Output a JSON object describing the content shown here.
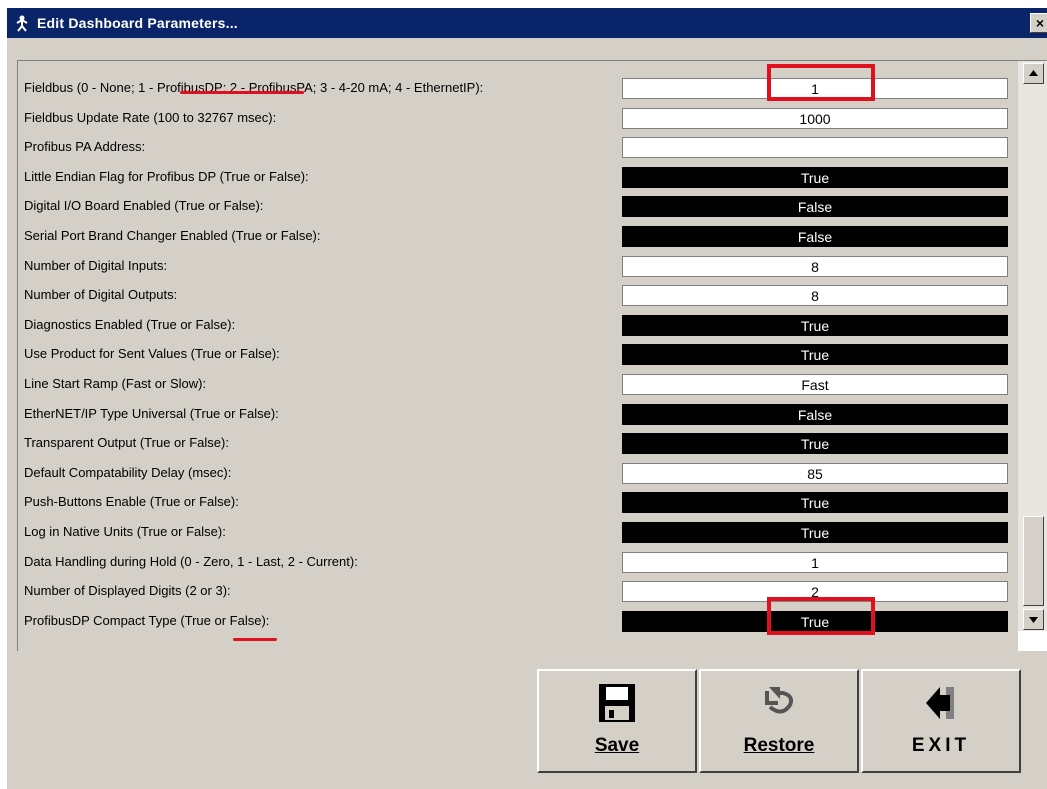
{
  "window": {
    "title": "Edit Dashboard Parameters...",
    "close_label": "×"
  },
  "parameters": [
    {
      "label": "Fieldbus (0 - None; 1 - ProfibusDP; 2 - ProfibusPA; 3 - 4-20 mA; 4 - EthernetIP):",
      "value": "1",
      "style": "white"
    },
    {
      "label": "Fieldbus Update Rate (100 to 32767 msec):",
      "value": "1000",
      "style": "white"
    },
    {
      "label": "Profibus  PA Address:",
      "value": "",
      "style": "white"
    },
    {
      "label": "Little Endian Flag for Profibus DP (True or False):",
      "value": "True",
      "style": "black"
    },
    {
      "label": "Digital I/O Board Enabled (True or False):",
      "value": "False",
      "style": "black"
    },
    {
      "label": "Serial Port Brand Changer Enabled (True or False):",
      "value": "False",
      "style": "black"
    },
    {
      "label": "Number of Digital Inputs:",
      "value": "8",
      "style": "white"
    },
    {
      "label": "Number of Digital Outputs:",
      "value": "8",
      "style": "white"
    },
    {
      "label": "Diagnostics Enabled (True or False):",
      "value": "True",
      "style": "black"
    },
    {
      "label": "Use Product for Sent Values (True or False):",
      "value": "True",
      "style": "black"
    },
    {
      "label": "Line Start Ramp (Fast or Slow):",
      "value": "Fast",
      "style": "white"
    },
    {
      "label": "EtherNET/IP Type Universal (True or False):",
      "value": "False",
      "style": "black"
    },
    {
      "label": "Transparent Output (True or False):",
      "value": "True",
      "style": "black"
    },
    {
      "label": "Default Compatability Delay (msec):",
      "value": "85",
      "style": "white"
    },
    {
      "label": "Push-Buttons Enable (True or False):",
      "value": "True",
      "style": "black"
    },
    {
      "label": "Log in Native Units (True or False):",
      "value": "True",
      "style": "black"
    },
    {
      "label": "Data Handling during Hold (0 - Zero, 1 - Last, 2 - Current):",
      "value": "1",
      "style": "white"
    },
    {
      "label": "Number of Displayed Digits (2 or 3):",
      "value": "2",
      "style": "white"
    },
    {
      "label": "ProfibusDP Compact Type (True or False):",
      "value": "True",
      "style": "black"
    }
  ],
  "buttons": {
    "save": "Save",
    "restore": "Restore",
    "exit": "EXIT"
  },
  "colors": {
    "titlebar": "#0a246a",
    "highlight": "#e0101e",
    "dialog": "#d4d0c8"
  },
  "icons": {
    "save": "floppy-disk-icon",
    "restore": "undo-arrow-icon",
    "exit": "exit-arrow-icon"
  }
}
